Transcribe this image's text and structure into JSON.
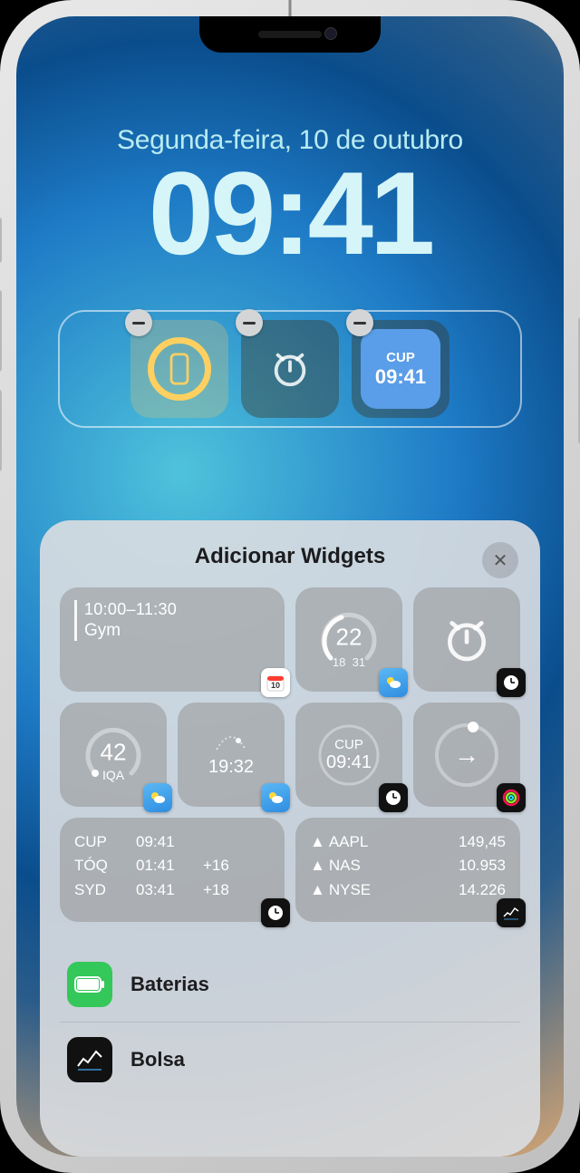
{
  "lock": {
    "date": "Segunda-feira, 10 de outubro",
    "time": "09:41"
  },
  "tray_widgets": {
    "cup": {
      "label": "CUP",
      "time": "09:41"
    }
  },
  "sheet": {
    "title": "Adicionar Widgets"
  },
  "suggestions": {
    "calendar": {
      "time_range": "10:00–11:30",
      "event": "Gym"
    },
    "weather": {
      "temp": "22",
      "lo": "18",
      "hi": "31"
    },
    "aqi": {
      "value": "42",
      "label": "IQA"
    },
    "sunset": {
      "time": "19:32"
    },
    "world_clock_single": {
      "city": "CUP",
      "time": "09:41"
    },
    "world_clock_list": [
      {
        "city": "CUP",
        "time": "09:41",
        "offset": ""
      },
      {
        "city": "TÓQ",
        "time": "01:41",
        "offset": "+16"
      },
      {
        "city": "SYD",
        "time": "03:41",
        "offset": "+18"
      }
    ],
    "stocks": [
      {
        "sym": "AAPL",
        "val": "149,45"
      },
      {
        "sym": "NAS",
        "val": "10.953"
      },
      {
        "sym": "NYSE",
        "val": "14.226"
      }
    ]
  },
  "app_categories": [
    {
      "key": "batteries",
      "label": "Baterias"
    },
    {
      "key": "stocks",
      "label": "Bolsa"
    }
  ],
  "glyphs": {
    "close": "✕",
    "up_tri": "▲",
    "arrow": "→"
  }
}
